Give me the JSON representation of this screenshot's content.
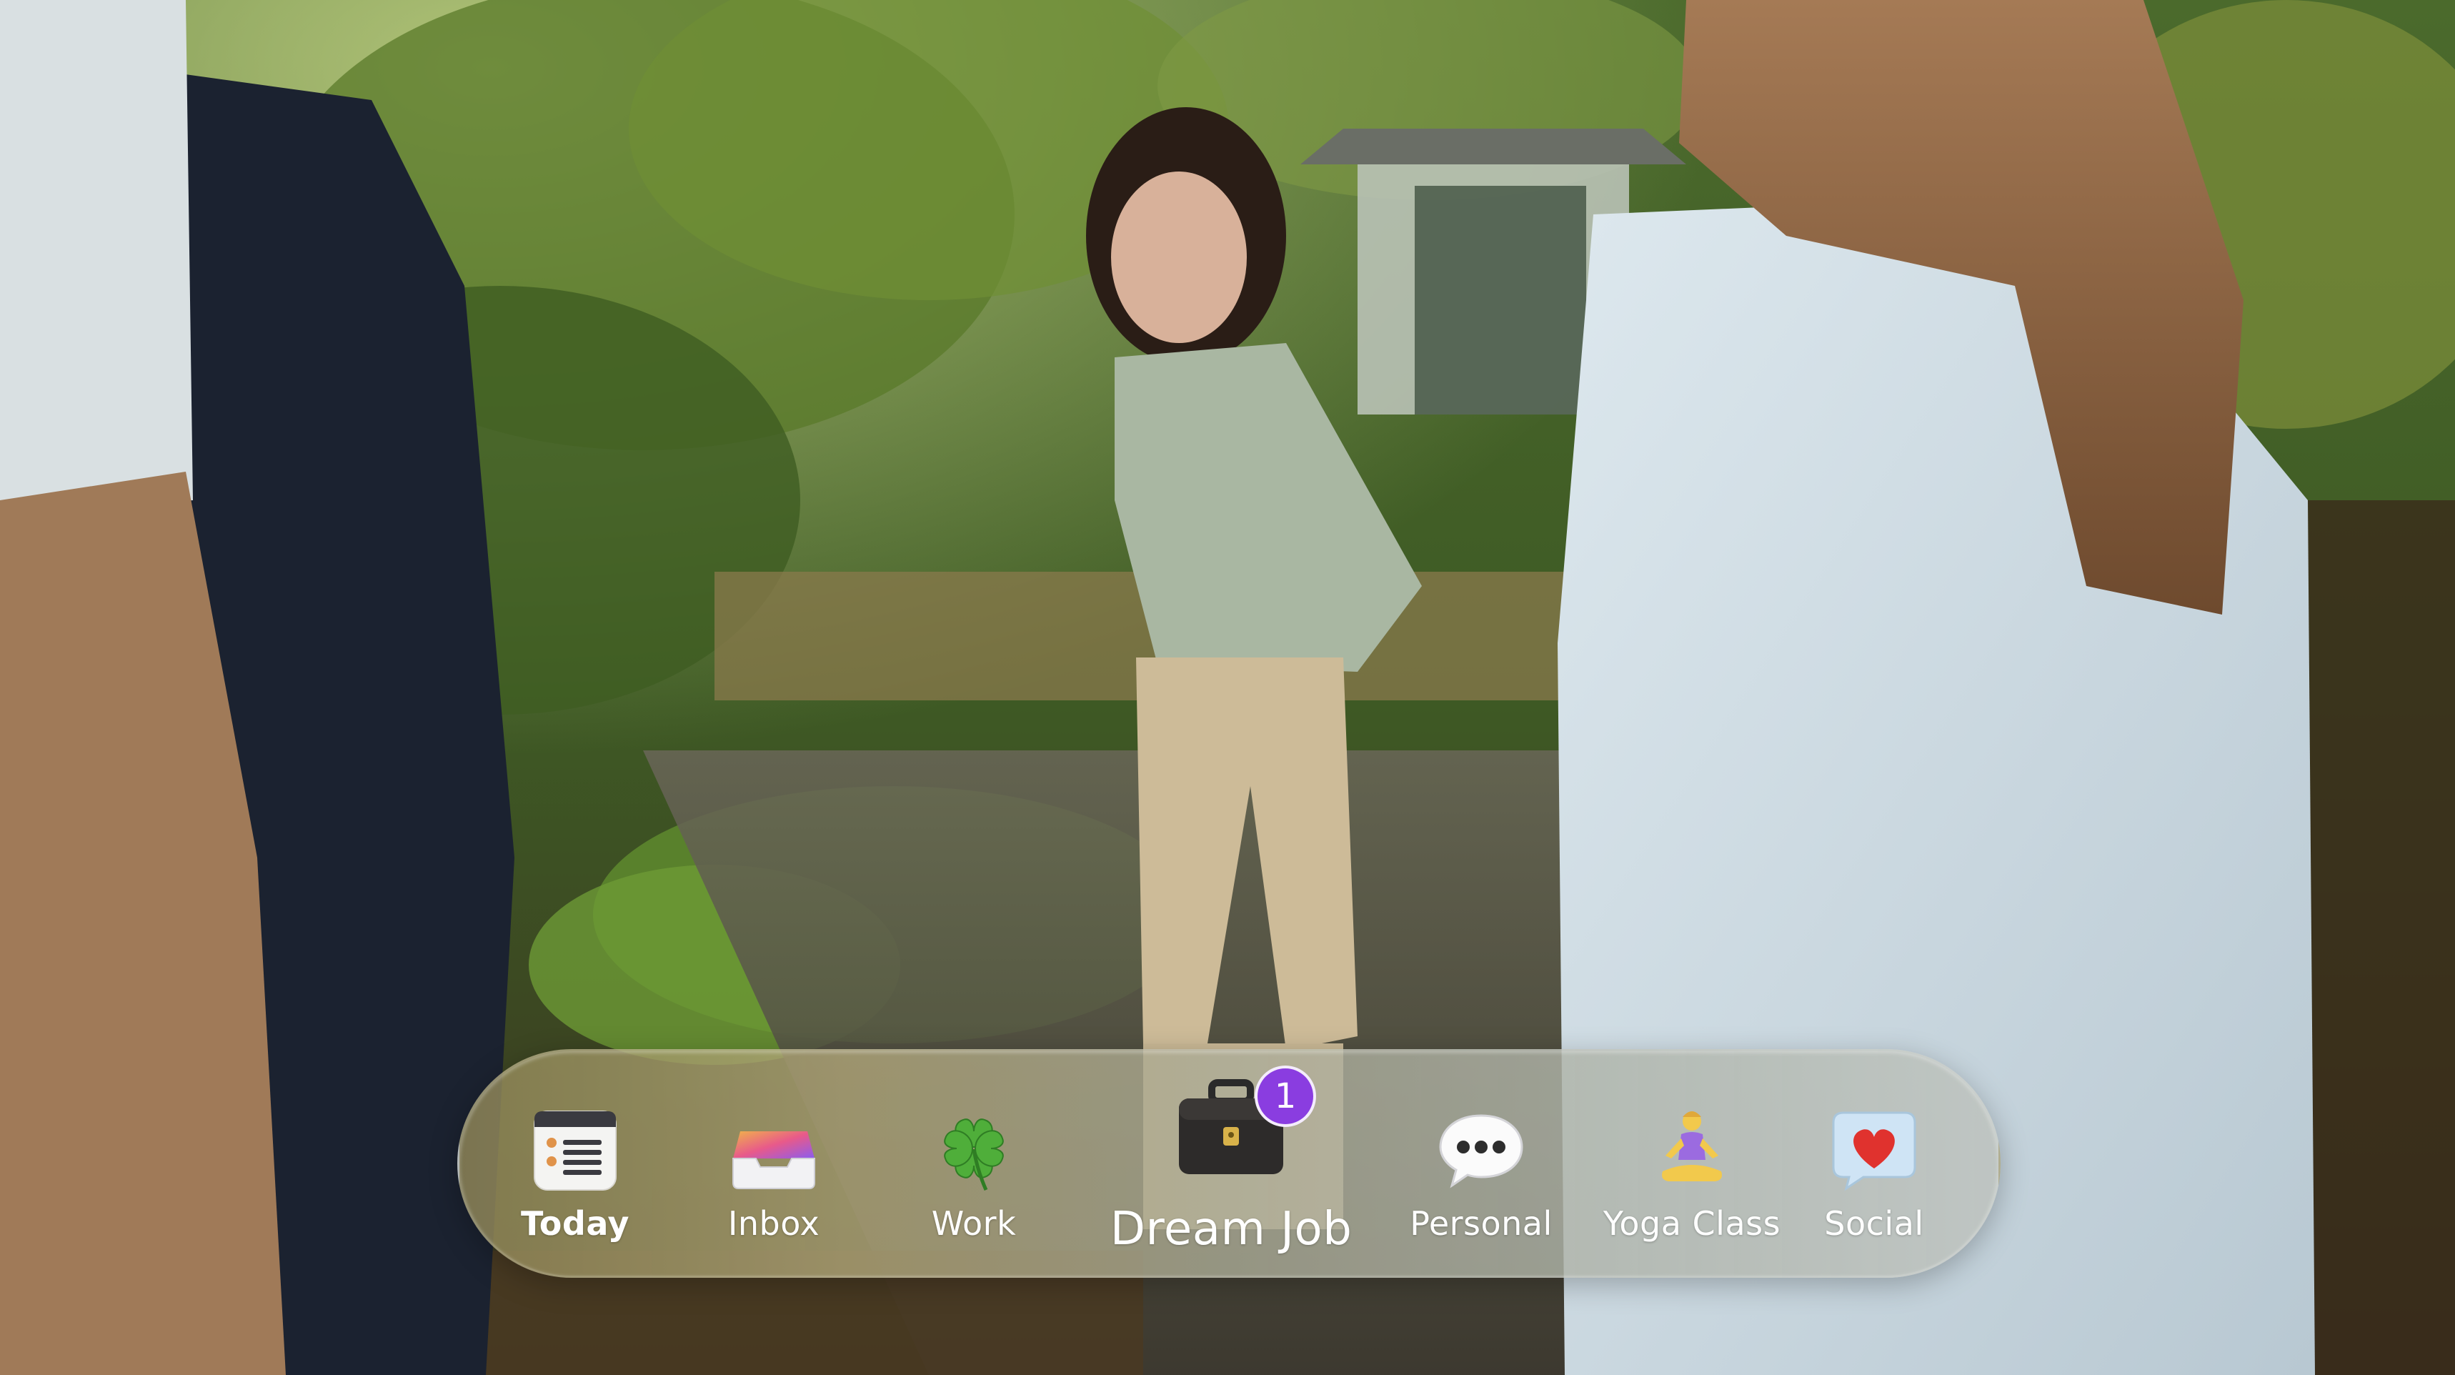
{
  "dock": {
    "items": [
      {
        "label": "Today",
        "icon": "today-list-icon",
        "active": true
      },
      {
        "label": "Inbox",
        "icon": "inbox-tray-icon"
      },
      {
        "label": "Work",
        "icon": "four-leaf-clover-icon"
      },
      {
        "label": "Dream Job",
        "icon": "briefcase-icon",
        "badge": "1",
        "featured": true
      },
      {
        "label": "Personal",
        "icon": "speech-bubble-icon"
      },
      {
        "label": "Yoga Class",
        "icon": "meditating-person-icon"
      },
      {
        "label": "Social",
        "icon": "heart-bubble-icon"
      }
    ]
  },
  "colors": {
    "badge": "#8a3de0",
    "label": "#ffffff"
  }
}
